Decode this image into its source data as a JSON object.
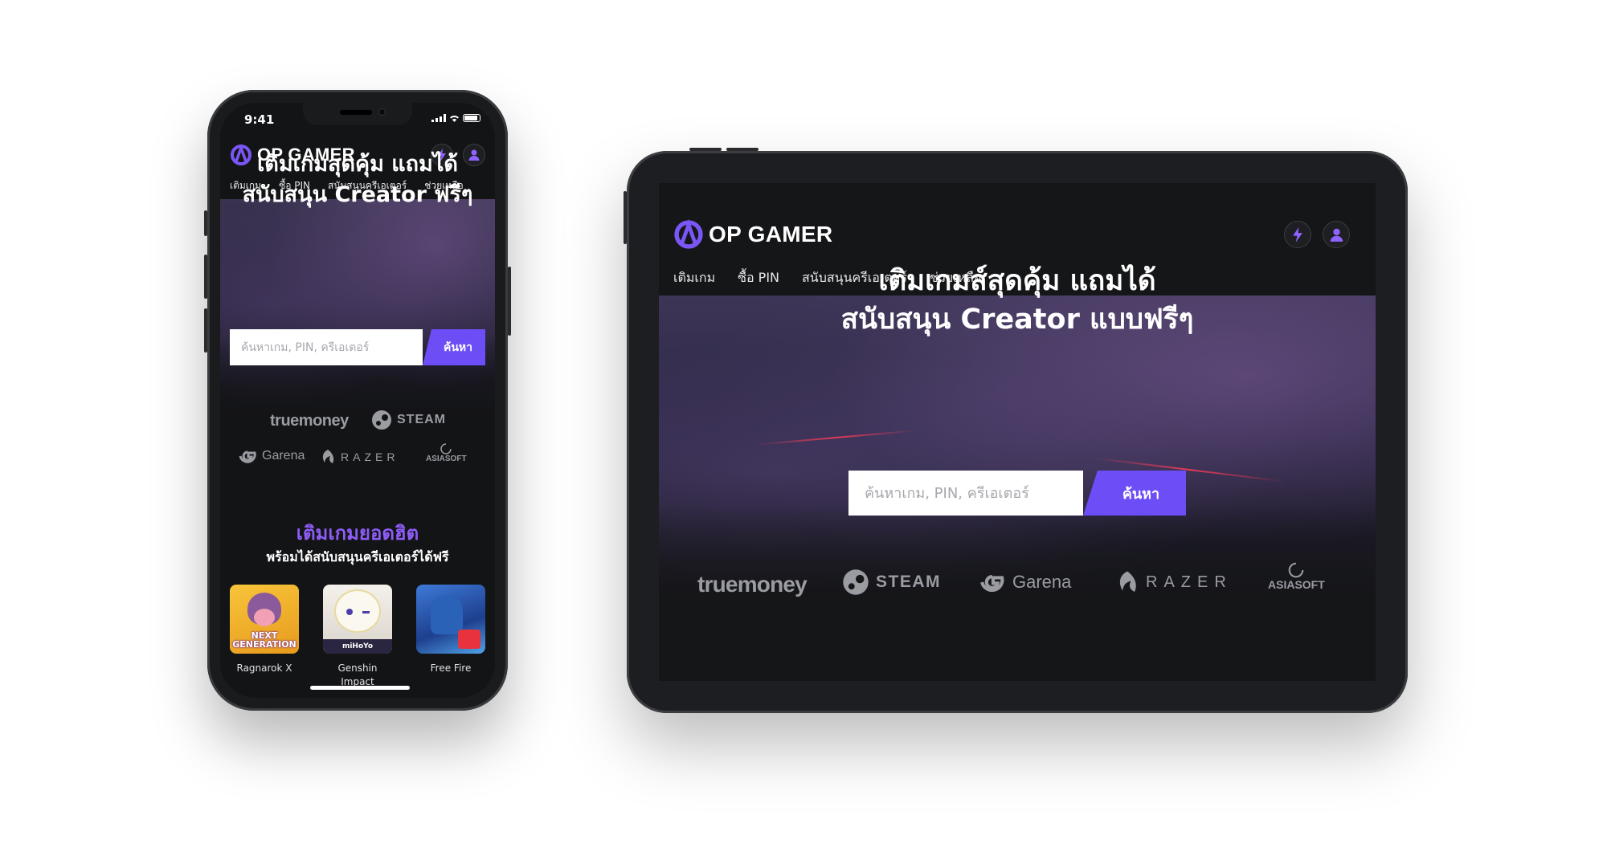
{
  "colors": {
    "accent": "#6c4df6",
    "accent_text": "#8e5cf7",
    "bg_dark": "#131416"
  },
  "brand": {
    "name": "OP GAMER"
  },
  "phone": {
    "status_time": "9:41",
    "nav": [
      "เติมเกม",
      "ซื้อ PIN",
      "สนับสนุนครีเอเตอร์",
      "ช่วยเหลือ"
    ],
    "hero_line1": "เติมเกมสุดคุ้ม แถมได้",
    "hero_line2": "สนับสนุน Creator ฟรีๆ",
    "search_placeholder": "ค้นหาเกม, PIN, ครีเอเตอร์",
    "search_button": "ค้นหา",
    "popular_title": "เติมเกมยอดฮิต",
    "popular_subtitle": "พร้อมได้สนับสนุนครีเอเตอร์ได้ฟรี",
    "games": [
      {
        "name": "Ragnarok X",
        "badge": "NEXT GENERATION"
      },
      {
        "name": "Genshin Impact",
        "badge": "miHoYo"
      },
      {
        "name": "Free Fire",
        "badge": ""
      }
    ]
  },
  "tablet": {
    "nav": [
      "เติมเกม",
      "ซื้อ PIN",
      "สนับสนุนครีเอเตอร์",
      "ช่วยเหลือ"
    ],
    "hero_line1": "เติมเกมส์สุดคุ้ม แถมได้",
    "hero_line2": "สนับสนุน Creator แบบฟรีๆ",
    "search_placeholder": "ค้นหาเกม, PIN, ครีเอเตอร์",
    "search_button": "ค้นหา"
  },
  "partners": [
    "truemoney",
    "STEAM",
    "Garena",
    "RAZER",
    "ASIASOFT"
  ],
  "icons": [
    "logo-icon",
    "lightning-icon",
    "user-icon",
    "steam-icon",
    "garena-icon",
    "razer-icon",
    "asiasoft-icon"
  ]
}
